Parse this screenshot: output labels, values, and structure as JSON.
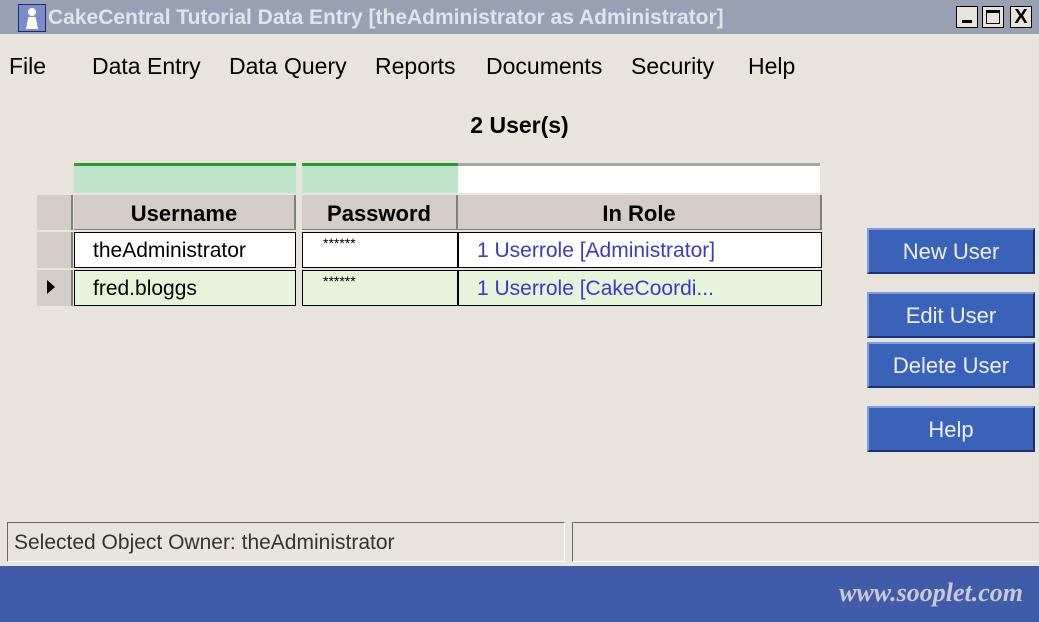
{
  "window": {
    "title": "CakeCentral Tutorial Data Entry [theAdministrator as Administrator]",
    "close_glyph": "X"
  },
  "menu": [
    "File",
    "Data Entry",
    "Data Query",
    "Reports",
    "Documents",
    "Security",
    "Help"
  ],
  "heading": "2 User(s)",
  "table": {
    "columns": [
      "Username",
      "Password",
      "In Role"
    ],
    "rows": [
      {
        "username": "theAdministrator",
        "password": "******",
        "role": "1 Userrole [Administrator]",
        "selected": false
      },
      {
        "username": "fred.bloggs",
        "password": "******",
        "role": "1 Userrole [CakeCoordi...",
        "selected": true
      }
    ],
    "row_colors": [
      "#ffffff",
      "#e6f4dc"
    ]
  },
  "buttons": [
    "New User",
    "Edit User",
    "Delete User",
    "Help"
  ],
  "status": {
    "left": "Selected Object Owner: theAdministrator",
    "right": ""
  },
  "footer": "www.sooplet.com",
  "colors": {
    "titlebar": "#97a1b3",
    "button": "#3a62b9",
    "footer": "#405ca8",
    "filter": "#bfe4ca",
    "role_link": "#3a3ac4"
  }
}
